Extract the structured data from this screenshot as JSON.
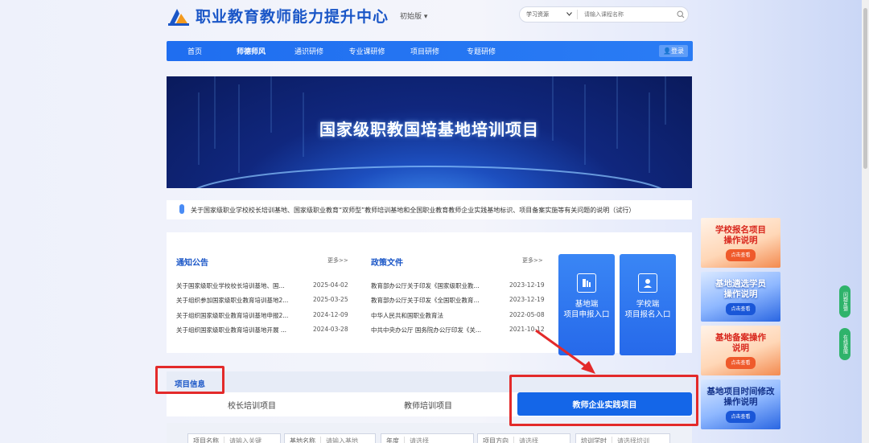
{
  "header": {
    "site_title": "职业教育教师能力提升中心",
    "version_label": "初始版 ▾",
    "search_type": "学习资源",
    "search_placeholder": "请输入课程名称"
  },
  "nav": {
    "items": [
      "首页",
      "师德师风",
      "通识研修",
      "专业课研修",
      "项目研修",
      "专题研修"
    ],
    "active_index": 1,
    "login_label": "登录"
  },
  "banner": {
    "title": "国家级职教国培基地培训项目"
  },
  "notice": {
    "text": "关于国家级职业学校校长培训基地、国家级职业教育“双师型”教师培训基地和全国职业教育教师企业实践基地标识、项目备案实施等有关问题的说明（试行）"
  },
  "news": {
    "left": {
      "title": "通知公告",
      "more": "更多>>",
      "rows": [
        {
          "title": "关于国家级职业学校校长培训基地、国...",
          "date": "2025-04-02"
        },
        {
          "title": "关于组织参加国家级职业教育培训基地2...",
          "date": "2025-03-25"
        },
        {
          "title": "关于组织国家级职业教育培训基地申报2...",
          "date": "2024-12-09"
        },
        {
          "title": "关于组织国家级职业教育培训基地开展 ...",
          "date": "2024-03-28"
        }
      ]
    },
    "right": {
      "title": "政策文件",
      "more": "更多>>",
      "rows": [
        {
          "title": "教育部办公厅关于印发《国家级职业教...",
          "date": "2023-12-19"
        },
        {
          "title": "教育部办公厅关于印发《全国职业教育...",
          "date": "2023-12-19"
        },
        {
          "title": "中华人民共和国职业教育法",
          "date": "2022-05-08"
        },
        {
          "title": "中共中央办公厅 国务院办公厅印发《关...",
          "date": "2021-10-12"
        }
      ]
    }
  },
  "entries": [
    {
      "line1": "基地端",
      "line2": "项目申报入口"
    },
    {
      "line1": "学校端",
      "line2": "项目报名入口"
    }
  ],
  "project": {
    "section_title": "项目信息",
    "tabs": [
      "校长培训项目",
      "教师培训项目",
      "教师企业实践项目"
    ],
    "active_tab": 2,
    "filters": [
      {
        "label": "项目名称",
        "value": "请输入关键"
      },
      {
        "label": "基地名称",
        "value": "请输入基地"
      },
      {
        "label": "年度",
        "value": "请选择"
      },
      {
        "label": "项目方向",
        "value": "请选择"
      },
      {
        "label": "培训学时",
        "value": "请选择培训"
      }
    ]
  },
  "promos": [
    {
      "line1": "学校报名项目",
      "line2": "操作说明",
      "btn": "点击查看"
    },
    {
      "line1": "基地遴选学员",
      "line2": "操作说明",
      "btn": "点击查看"
    },
    {
      "line1": "基地备案操作",
      "line2": "说明",
      "btn": "点击查看"
    },
    {
      "line1": "基地项目时间修改",
      "line2": "操作说明",
      "btn": "点击查看"
    }
  ],
  "float_buttons": [
    {
      "label": "问题反馈"
    },
    {
      "label": "在线客服"
    }
  ],
  "colors": {
    "primary": "#1466e8",
    "nav": "#1f6ef0",
    "annotation": "#e32a2a"
  }
}
